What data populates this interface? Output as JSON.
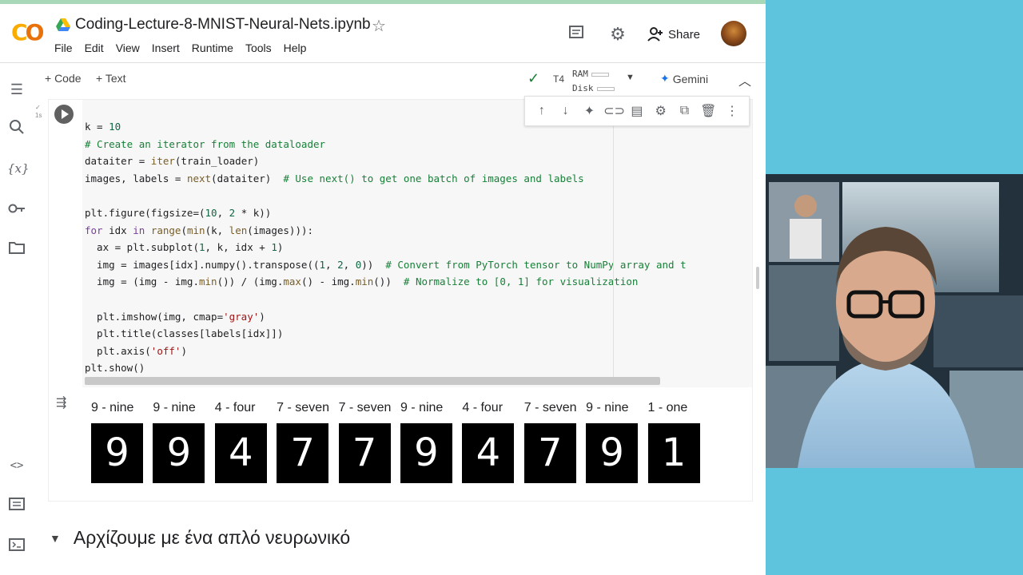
{
  "app": {
    "notebook_title": "Coding-Lecture-8-MNIST-Neural-Nets.ipynb",
    "share_label": "Share",
    "menu": [
      "File",
      "Edit",
      "Insert",
      "Runtime",
      "Tools",
      "Help"
    ]
  },
  "toolbar": {
    "add_code": "+ Code",
    "add_text": "+ Text",
    "runtime_type": "T4",
    "ram_label": "RAM",
    "disk_label": "Disk",
    "gemini_label": "Gemini"
  },
  "cell": {
    "exec_indicator": "1s",
    "code_lines": [
      "k = 10",
      "# Create an iterator from the dataloader",
      "dataiter = iter(train_loader)",
      "images, labels = next(dataiter)  # Use next() to get one batch of images and labels",
      "",
      "plt.figure(figsize=(10, 2 * k))",
      "for idx in range(min(k, len(images))):",
      "  ax = plt.subplot(1, k, idx + 1)",
      "  img = images[idx].numpy().transpose((1, 2, 0))  # Convert from PyTorch tensor to NumPy array and t",
      "  img = (img - img.min()) / (img.max() - img.min())  # Normalize to [0, 1] for visualization",
      "",
      "  plt.imshow(img, cmap='gray')",
      "  plt.title(classes[labels[idx]])",
      "  plt.axis('off')",
      "plt.show()"
    ],
    "output_images": [
      {
        "label": "9 - nine",
        "glyph": "9"
      },
      {
        "label": "9 - nine",
        "glyph": "9"
      },
      {
        "label": "4 - four",
        "glyph": "4"
      },
      {
        "label": "7 - seven",
        "glyph": "7"
      },
      {
        "label": "7 - seven",
        "glyph": "7"
      },
      {
        "label": "9 - nine",
        "glyph": "9"
      },
      {
        "label": "4 - four",
        "glyph": "4"
      },
      {
        "label": "7 - seven",
        "glyph": "7"
      },
      {
        "label": "9 - nine",
        "glyph": "9"
      },
      {
        "label": "1 - one",
        "glyph": "1"
      }
    ]
  },
  "section": {
    "heading": "Αρχίζουμε με ένα απλό νευρωνικό"
  },
  "icons": {
    "header": [
      "comment-icon",
      "settings-icon",
      "share-person-icon"
    ],
    "sidebar": [
      "toc-icon",
      "search-icon",
      "variables-icon",
      "secrets-key-icon",
      "folder-icon",
      "code-snippets-icon",
      "command-palette-icon",
      "terminal-icon"
    ],
    "cell_toolbar": [
      "move-up-icon",
      "move-down-icon",
      "gemini-spark-icon",
      "link-icon",
      "comment-icon",
      "settings-icon",
      "mirror-cell-icon",
      "delete-icon",
      "more-icon"
    ]
  },
  "colors": {
    "run_status_check": "#188038",
    "gemini_accent": "#1a73e8",
    "logo_orange": "#f9ab00",
    "background_right": "#5ec4dd"
  }
}
